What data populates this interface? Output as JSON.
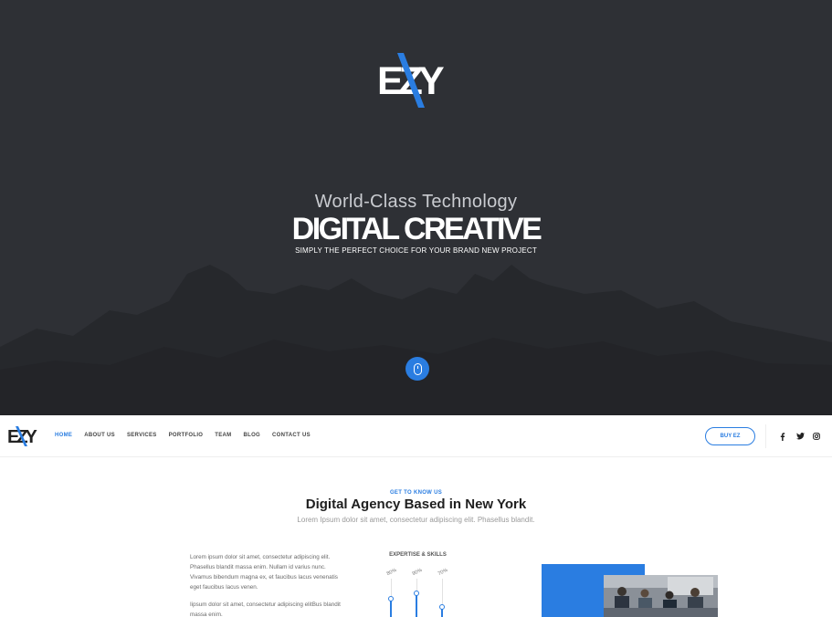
{
  "hero": {
    "logo_text": "EZY",
    "subtitle": "World-Class Technology",
    "title": "DIGITAL CREATIVE",
    "tagline": "SIMPLY THE PERFECT CHOICE FOR YOUR BRAND NEW PROJECT",
    "background_color": "#2e3035",
    "accent_color": "#2a7de1"
  },
  "nav": {
    "logo_text": "EZY",
    "items": [
      {
        "label": "HOME",
        "active": true
      },
      {
        "label": "ABOUT US",
        "active": false
      },
      {
        "label": "SERVICES",
        "active": false
      },
      {
        "label": "PORTFOLIO",
        "active": false
      },
      {
        "label": "TEAM",
        "active": false
      },
      {
        "label": "BLOG",
        "active": false
      },
      {
        "label": "CONTACT US",
        "active": false
      }
    ],
    "buy_label": "BUY EZ",
    "social_icons": [
      {
        "icon": "facebook-icon",
        "glyph": "f"
      },
      {
        "icon": "twitter-icon",
        "glyph": "t"
      },
      {
        "icon": "instagram-icon",
        "glyph": "o"
      }
    ]
  },
  "about": {
    "eyebrow": "GET TO KNOW US",
    "title": "Digital Agency Based in New York",
    "lead": "Lorem Ipsum dolor sit amet, consectetur adipiscing elit. Phasellus blandit.",
    "paragraph1": "Lorem ipsum dolor sit amet, consectetur adipiscing elit. Phasellus blandit massa enim. Nullam id varius nunc. Vivamus bibendum magna ex, et faucibus lacus venenatis eget faucibus lacus venen.",
    "paragraph2": "Iipsum dolor sit amet, consectetur adipiscing elitBus blandit massa enim.",
    "skills_title": "EXPERTISE & SKILLS",
    "skills": [
      {
        "label": "80%",
        "value": 80
      },
      {
        "label": "90%",
        "value": 90
      },
      {
        "label": "70%",
        "value": 70
      }
    ]
  }
}
